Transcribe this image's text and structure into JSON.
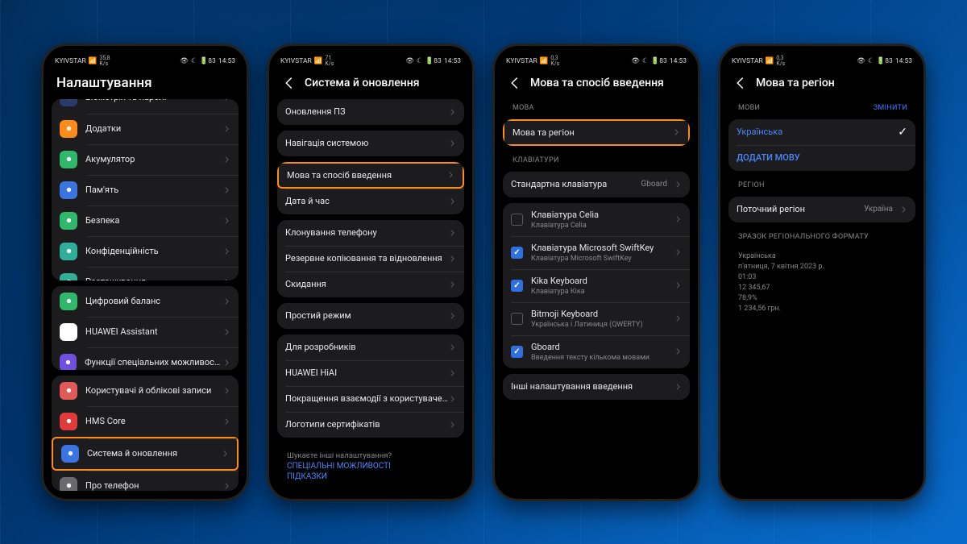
{
  "status": {
    "carrier": "KYIVSTAR",
    "speed_val": "35,8",
    "speed_unit": "K/s",
    "speed2_val": "71",
    "speed3_val": "0,3",
    "battery": "83",
    "time": "14:53"
  },
  "phone1": {
    "title": "Налаштування",
    "items": [
      {
        "label": "Біометрія та паролі",
        "color": "#2a3a6a"
      },
      {
        "label": "Додатки",
        "color": "#ff8c1a"
      },
      {
        "label": "Акумулятор",
        "color": "#2fb86b"
      },
      {
        "label": "Пам'ять",
        "color": "#3a74e0"
      },
      {
        "label": "Безпека",
        "color": "#2fb86b"
      },
      {
        "label": "Конфіденційність",
        "color": "#2fae9a"
      },
      {
        "label": "Розташування",
        "color": "#2fae9a"
      }
    ],
    "items2": [
      {
        "label": "Цифровий баланс",
        "color": "#2fb86b"
      },
      {
        "label": "HUAWEI Assistant",
        "color": "#ffffff"
      },
      {
        "label": "Функції спеціальних можливостей",
        "color": "#6f4ee0"
      }
    ],
    "items3": [
      {
        "label": "Користувачі й облікові записи",
        "color": "#e05a5a"
      },
      {
        "label": "HMS Core",
        "color": "#e03a3a"
      },
      {
        "label": "Система й оновлення",
        "color": "#3a74e0",
        "hl": true
      },
      {
        "label": "Про телефон",
        "color": "#6a6a6e"
      }
    ]
  },
  "phone2": {
    "title": "Система й оновлення",
    "g1": [
      "Оновлення ПЗ"
    ],
    "g2": [
      "Навігація системою"
    ],
    "g3": [
      "Мова та спосіб введення",
      "Дата й час"
    ],
    "g4": [
      "Клонування телефону",
      "Резервне копіювання та відновлення",
      "Скидання"
    ],
    "g5": [
      "Простий режим"
    ],
    "g6": [
      "Для розробників",
      "HUAWEI HiAI",
      "Покращення взаємодії з користувачем",
      "Логотипи сертифікатів"
    ],
    "search": {
      "q": "Шукаєте інші налаштування?",
      "l1": "СПЕЦІАЛЬНІ МОЖЛИВОСТІ",
      "l2": "ПІДКАЗКИ"
    }
  },
  "phone3": {
    "title": "Мова та спосіб введення",
    "sec1": "МОВА",
    "lang_region": "Мова та регіон",
    "sec2": "КЛАВІАТУРИ",
    "default_kb_label": "Стандартна клавіатура",
    "default_kb_value": "Gboard",
    "kbs": [
      {
        "name": "Клавіатура Celia",
        "sub": "Клавіатура Celia",
        "checked": false
      },
      {
        "name": "Клавіатура Microsoft SwiftKey",
        "sub": "Клавіатура Microsoft SwiftKey",
        "checked": true
      },
      {
        "name": "Kika Keyboard",
        "sub": "Клавіатура Кіка",
        "checked": true
      },
      {
        "name": "Bitmoji Keyboard",
        "sub": "Українська і Латиниця (QWERTY)",
        "checked": false
      },
      {
        "name": "Gboard",
        "sub": "Введення тексту кількома мовами",
        "checked": true
      }
    ],
    "more": "Інші налаштування введення"
  },
  "phone4": {
    "title": "Мова та регіон",
    "sec1": "МОВИ",
    "change": "ЗМІНИТИ",
    "lang": "Українська",
    "add": "ДОДАТИ МОВУ",
    "sec2": "РЕГІОН",
    "region_label": "Поточний регіон",
    "region_value": "Україна",
    "fmt_hdr": "ЗРАЗОК РЕГІОНАЛЬНОГО ФОРМАТУ",
    "fmt": [
      "Українська",
      "п'ятниця, 7 квітня 2023 р.",
      "01:03",
      "12 345,67",
      "78,9%",
      "1 234,56 грн."
    ]
  }
}
